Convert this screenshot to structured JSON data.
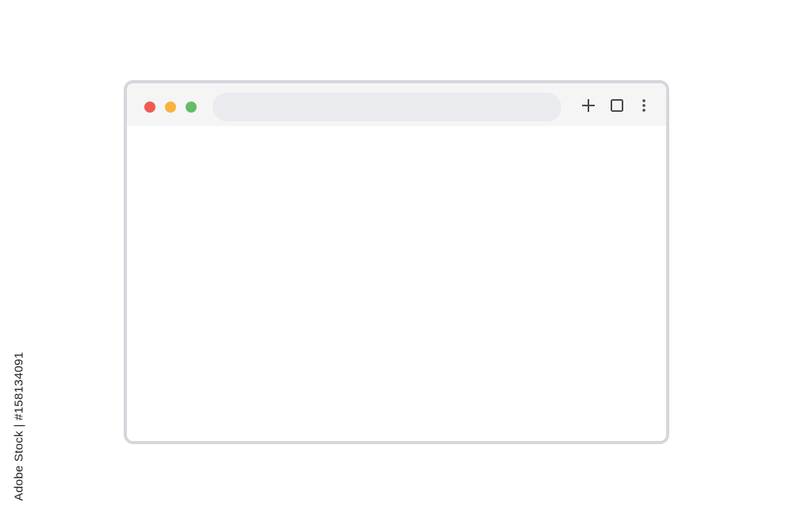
{
  "window": {
    "traffic_lights": [
      {
        "name": "close",
        "color": "#f05a50"
      },
      {
        "name": "minimize",
        "color": "#f7b33c"
      },
      {
        "name": "maximize",
        "color": "#66bb6a"
      }
    ],
    "address_bar": {
      "value": ""
    },
    "toolbar": {
      "new_tab_icon": "plus-icon",
      "restore_icon": "square-icon",
      "menu_icon": "vertical-dots-icon",
      "icon_color": "#4a4a4a"
    },
    "frame_color": "#d4d7db",
    "titlebar_color": "#f5f5f6",
    "address_bar_color": "#e9ebee"
  },
  "watermark": {
    "stock_id": "Adobe Stock | #158134091"
  }
}
